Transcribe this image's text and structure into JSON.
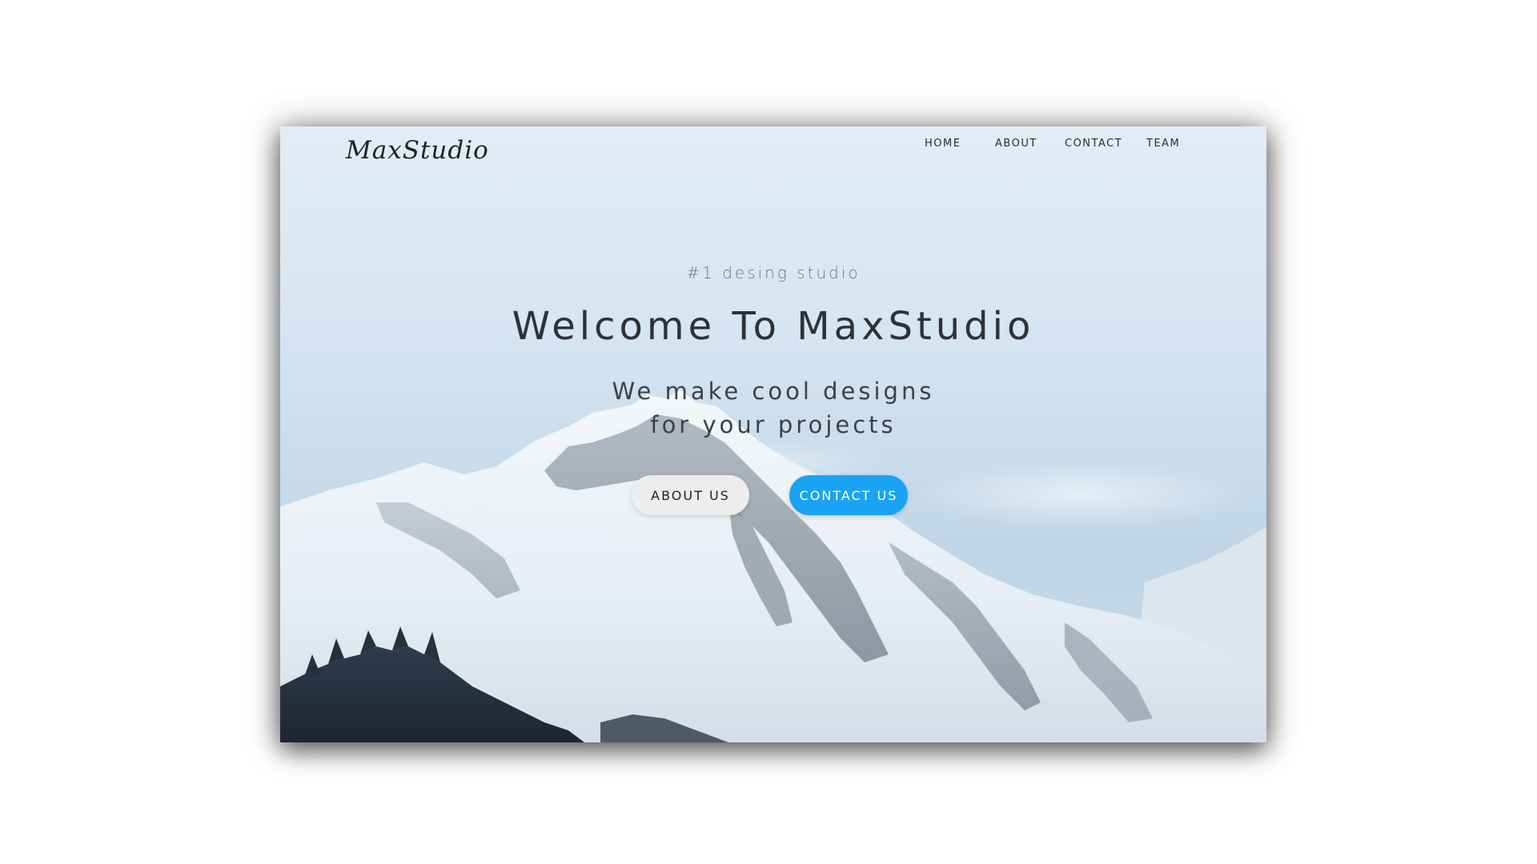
{
  "nav": {
    "brand": "MaxStudio",
    "links": [
      "HOME",
      "ABOUT",
      "CONTACT",
      "TEAM"
    ]
  },
  "hero": {
    "tagline": "#1 desing studio",
    "headline": "Welcome To MaxStudio",
    "subline_1": "We make cool designs",
    "subline_2": "for your projects",
    "about_button": "ABOUT US",
    "contact_button": "CONTACT US"
  },
  "colors": {
    "accent": "#1aa3f2",
    "secondary_button": "#ededed",
    "text_dark": "#2e3236"
  }
}
